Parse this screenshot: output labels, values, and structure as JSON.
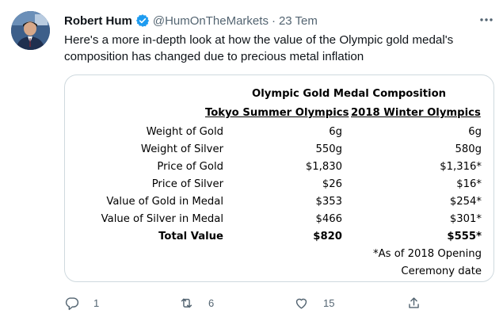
{
  "tweet": {
    "author_name": "Robert Hum",
    "handle": "@HumOnTheMarkets",
    "separator": "·",
    "time": "23 Tem",
    "text": "Here's a more in-depth look at how the value of the Olympic gold medal's composition has changed due to precious metal inflation"
  },
  "table": {
    "title": "Olympic Gold Medal Composition",
    "col1_header": "Tokyo Summer Olympics",
    "col2_header": "2018 Winter Olympics",
    "rows": [
      {
        "label": "Weight of Gold",
        "tokyo": "6g",
        "winter": "6g"
      },
      {
        "label": "Weight of Silver",
        "tokyo": "550g",
        "winter": "580g"
      },
      {
        "label": "Price of Gold",
        "tokyo": "$1,830",
        "winter": "$1,316*"
      },
      {
        "label": "Price of Silver",
        "tokyo": "$26",
        "winter": "$16*"
      },
      {
        "label": "Value of Gold in Medal",
        "tokyo": "$353",
        "winter": "$254*"
      },
      {
        "label": "Value of Silver in Medal",
        "tokyo": "$466",
        "winter": "$301*"
      },
      {
        "label": "Total Value",
        "tokyo": "$820",
        "winter": "$555*"
      }
    ],
    "note_line1": "*As of 2018 Opening",
    "note_line2": "Ceremony date"
  },
  "actions": {
    "reply_count": "1",
    "retweet_count": "6",
    "like_count": "15"
  },
  "icons": {
    "verified": "verified-badge-icon",
    "more": "more-options-icon",
    "reply": "reply-icon",
    "retweet": "retweet-icon",
    "like": "like-icon",
    "share": "share-icon"
  },
  "colors": {
    "text": "#0f1419",
    "secondary": "#536471",
    "verified": "#1d9bf0",
    "border": "#cfd9de"
  }
}
